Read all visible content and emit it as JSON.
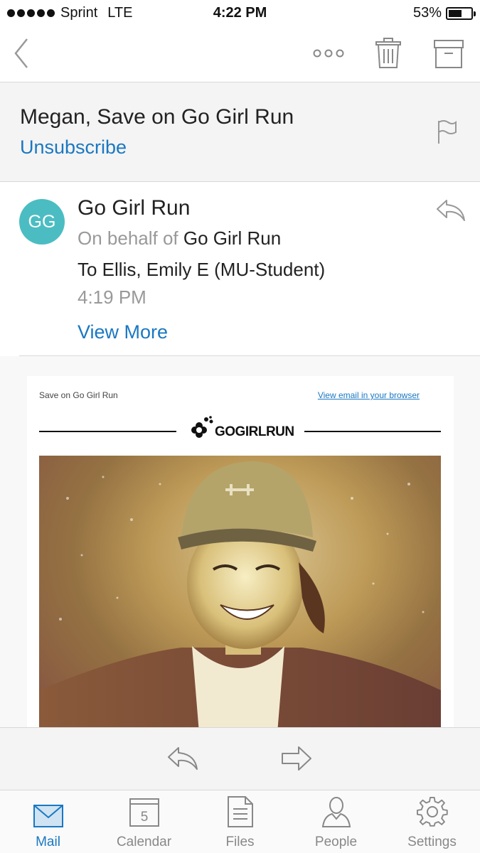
{
  "status_bar": {
    "carrier": "Sprint",
    "network": "LTE",
    "time": "4:22 PM",
    "battery": "53%",
    "battery_level": 0.53
  },
  "toolbar": {
    "back_icon": "chevron-left-icon",
    "more_icon": "more-horizontal-icon",
    "delete_icon": "trash-icon",
    "archive_icon": "archive-icon"
  },
  "subject": {
    "title": "Megan, Save on Go Girl Run",
    "unsubscribe": "Unsubscribe",
    "flag_icon": "flag-icon"
  },
  "sender": {
    "initials": "GG",
    "name": "Go Girl Run",
    "on_behalf_prefix": "On behalf of",
    "on_behalf_name": "Go Girl Run",
    "to": "To Ellis, Emily E (MU-Student)",
    "time": "4:19 PM",
    "view_more": "View More",
    "avatar_color": "#4bbdc2"
  },
  "email": {
    "preheader": "Save on Go Girl Run",
    "view_in_browser": "View email in your browser",
    "logo_text": "GOGIRLRUN"
  },
  "actions": {
    "reply_icon": "reply-icon",
    "forward_icon": "forward-icon"
  },
  "tabs": [
    {
      "label": "Mail",
      "icon": "mail-icon",
      "active": true
    },
    {
      "label": "Calendar",
      "icon": "calendar-icon",
      "day": "5"
    },
    {
      "label": "Files",
      "icon": "files-icon"
    },
    {
      "label": "People",
      "icon": "people-icon"
    },
    {
      "label": "Settings",
      "icon": "settings-icon"
    }
  ],
  "colors": {
    "accent": "#1a78c2",
    "divider": "#d8d8d8"
  }
}
